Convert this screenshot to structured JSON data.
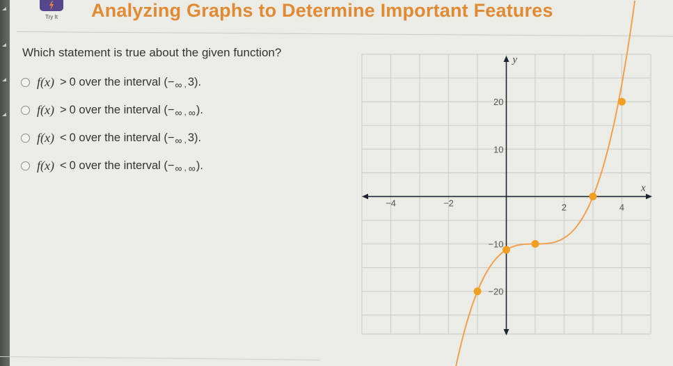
{
  "app": {
    "try_it_label": "Try It",
    "title": "Analyzing Graphs to Determine Important Features"
  },
  "question": {
    "prompt": "Which statement is true about the given function?",
    "options": [
      {
        "fx": "f(x)",
        "op": ">",
        "value": "0",
        "text": "over the interval (",
        "lower": "−",
        "lower_inf": "∞",
        "sep": ",",
        "upper": "3",
        "close": ")."
      },
      {
        "fx": "f(x)",
        "op": ">",
        "value": "0",
        "text": "over the interval (",
        "lower": "−",
        "lower_inf": "∞",
        "sep": ",",
        "upper": "∞",
        "close": ")."
      },
      {
        "fx": "f(x)",
        "op": "<",
        "value": "0",
        "text": "over the interval (",
        "lower": "−",
        "lower_inf": "∞",
        "sep": ",",
        "upper": "3",
        "close": ")."
      },
      {
        "fx": "f(x)",
        "op": "<",
        "value": "0",
        "text": "over the interval (",
        "lower": "−",
        "lower_inf": "∞",
        "sep": ",",
        "upper": "∞",
        "close": ")."
      }
    ],
    "selected": null
  },
  "colors": {
    "title": "#e08a33",
    "curve": "#f0a050",
    "point": "#f0a020",
    "grid": "#cfcfca",
    "axis": "#1e2430"
  },
  "chart_data": {
    "type": "line",
    "title": "",
    "xlabel": "x",
    "ylabel": "y",
    "xlim": [
      -5,
      5
    ],
    "ylim": [
      -29,
      30
    ],
    "x_grid_step": 1,
    "y_grid_step": 5,
    "x_tick_labels": [
      {
        "value": -4,
        "label": "−4"
      },
      {
        "value": -2,
        "label": "−2"
      },
      {
        "value": 2,
        "label": "2"
      },
      {
        "value": 4,
        "label": "4"
      }
    ],
    "y_tick_labels": [
      {
        "value": 20,
        "label": "20"
      },
      {
        "value": 10,
        "label": "10"
      },
      {
        "value": -10,
        "label": "−10"
      },
      {
        "value": -20,
        "label": "−20"
      }
    ],
    "function": "1.25*(x-1)^3 - 10",
    "curve_x_range": [
      -1.75,
      4.45
    ],
    "highlighted_points": [
      {
        "x": -1,
        "y": -20
      },
      {
        "x": 0,
        "y": -11.25
      },
      {
        "x": 1,
        "y": -10
      },
      {
        "x": 3,
        "y": 0
      },
      {
        "x": 4,
        "y": 20
      }
    ],
    "grid": true
  }
}
